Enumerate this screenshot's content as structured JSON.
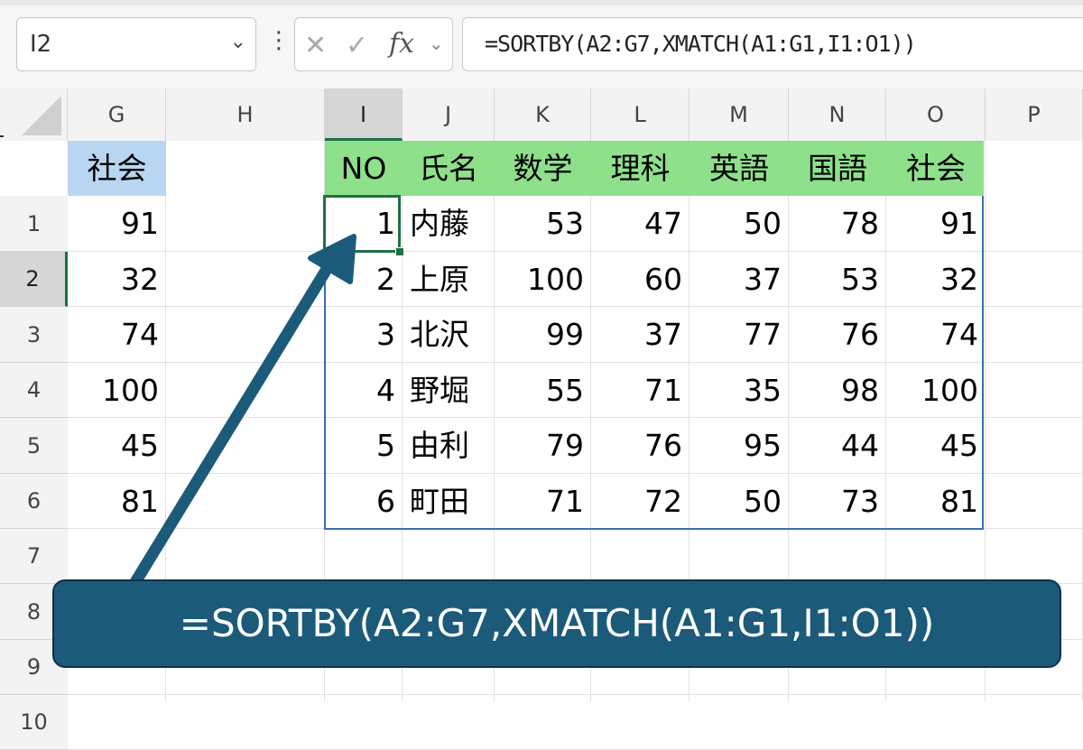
{
  "formula_bar": {
    "name_box": "I2",
    "name_box_chevron": "⌄",
    "dots": "⋮",
    "cancel_icon": "✕",
    "enter_icon": "✓",
    "fx_label": "fx",
    "fx_chevron": "⌄",
    "formula": "=SORTBY(A2:G7,XMATCH(A1:G1,I1:O1))"
  },
  "columns": [
    "G",
    "H",
    "I",
    "J",
    "K",
    "L",
    "M",
    "N",
    "O",
    "P"
  ],
  "rows": [
    "1",
    "2",
    "3",
    "4",
    "5",
    "6",
    "7",
    "8",
    "9",
    "10"
  ],
  "column_g": {
    "header": "社会",
    "values": [
      "91",
      "32",
      "74",
      "100",
      "45",
      "81"
    ]
  },
  "table": {
    "headers": [
      "NO",
      "氏名",
      "数学",
      "理科",
      "英語",
      "国語",
      "社会"
    ],
    "rows": [
      [
        "1",
        "内藤",
        "53",
        "47",
        "50",
        "78",
        "91"
      ],
      [
        "2",
        "上原",
        "100",
        "60",
        "37",
        "53",
        "32"
      ],
      [
        "3",
        "北沢",
        "99",
        "37",
        "77",
        "76",
        "74"
      ],
      [
        "4",
        "野堀",
        "55",
        "71",
        "35",
        "98",
        "100"
      ],
      [
        "5",
        "由利",
        "79",
        "76",
        "95",
        "44",
        "45"
      ],
      [
        "6",
        "町田",
        "71",
        "72",
        "50",
        "73",
        "81"
      ]
    ]
  },
  "callout": {
    "text": "=SORTBY(A2:G7,XMATCH(A1:G1,I1:O1))"
  },
  "colors": {
    "header_fill": "#8ee08b",
    "g1_fill": "#b8d6f1",
    "callout": "#1c5a7a",
    "selection": "#1e7145",
    "table_border": "#3d6db0"
  }
}
